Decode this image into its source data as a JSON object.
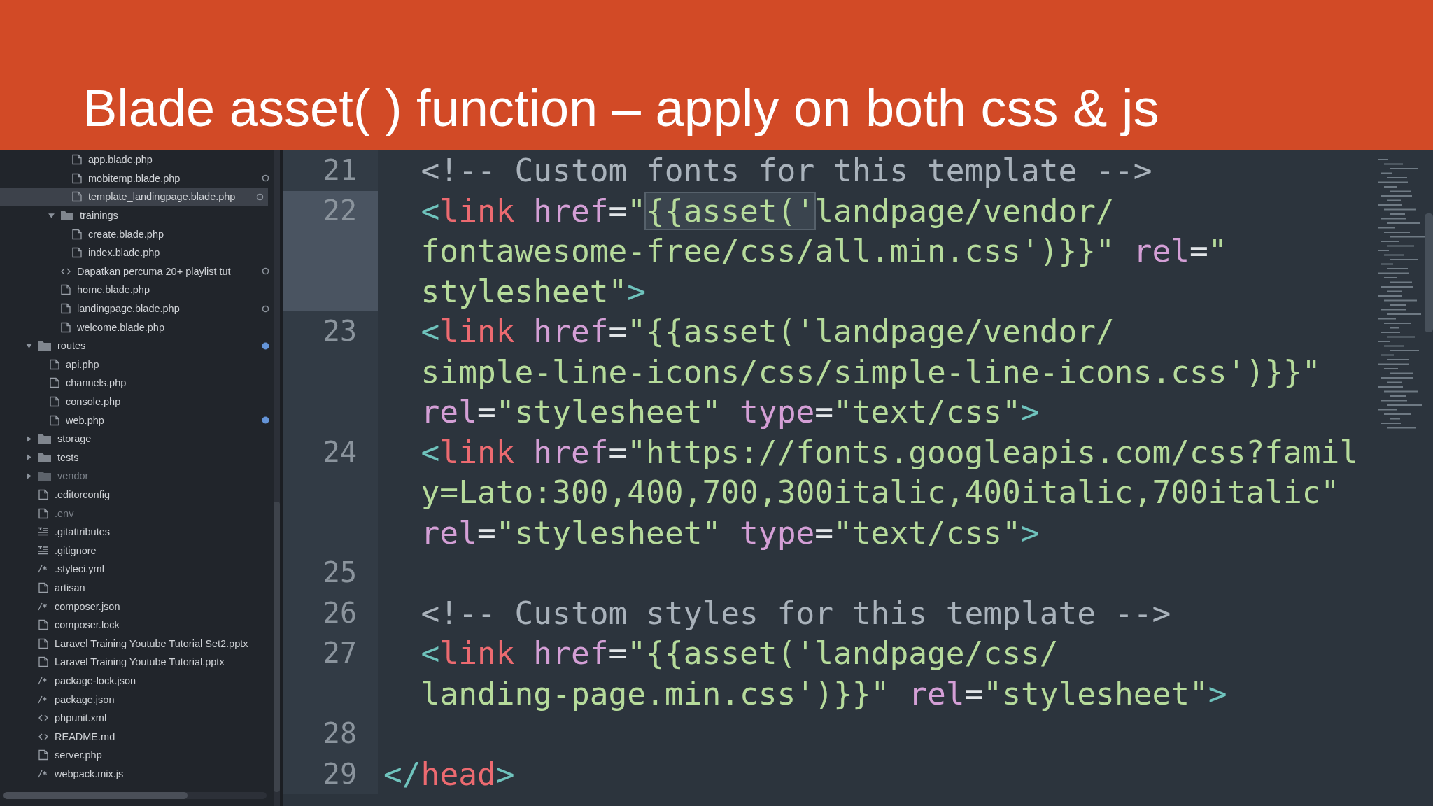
{
  "title": "Blade asset( ) function – apply on both css & js",
  "sidebar": {
    "tree": [
      {
        "children": [
          {
            "children": [
              {
                "children": [
                  {
                    "label": "app.blade.php",
                    "kind": "file",
                    "selected": false,
                    "dimmed": false,
                    "changed": false,
                    "modified": false
                  },
                  {
                    "label": "mobitemp.blade.php",
                    "kind": "file",
                    "selected": false,
                    "dimmed": false,
                    "changed": true,
                    "modified": false
                  },
                  {
                    "label": "template_landingpage.blade.php",
                    "kind": "file",
                    "selected": true,
                    "dimmed": false,
                    "changed": true,
                    "modified": false
                  }
                ]
              },
              {
                "label": "trainings",
                "kind": "folder",
                "expanded": true,
                "selected": false,
                "dimmed": false,
                "changed": false,
                "modified": false,
                "children": [
                  {
                    "label": "create.blade.php",
                    "kind": "file",
                    "selected": false,
                    "dimmed": false,
                    "changed": false,
                    "modified": false
                  },
                  {
                    "label": "index.blade.php",
                    "kind": "file",
                    "selected": false,
                    "dimmed": false,
                    "changed": false,
                    "modified": false
                  }
                ]
              },
              {
                "label": "Dapatkan percuma 20+ playlist tut",
                "kind": "code",
                "selected": false,
                "dimmed": false,
                "changed": true,
                "modified": false
              },
              {
                "label": "home.blade.php",
                "kind": "file",
                "selected": false,
                "dimmed": false,
                "changed": false,
                "modified": false
              },
              {
                "label": "landingpage.blade.php",
                "kind": "file",
                "selected": false,
                "dimmed": false,
                "changed": true,
                "modified": false
              },
              {
                "label": "welcome.blade.php",
                "kind": "file",
                "selected": false,
                "dimmed": false,
                "changed": false,
                "modified": false
              }
            ]
          }
        ]
      },
      {
        "label": "routes",
        "kind": "folder",
        "expanded": true,
        "selected": false,
        "dimmed": false,
        "changed": false,
        "modified": true,
        "children": [
          {
            "label": "api.php",
            "kind": "file",
            "selected": false,
            "dimmed": false,
            "changed": false,
            "modified": false
          },
          {
            "label": "channels.php",
            "kind": "file",
            "selected": false,
            "dimmed": false,
            "changed": false,
            "modified": false
          },
          {
            "label": "console.php",
            "kind": "file",
            "selected": false,
            "dimmed": false,
            "changed": false,
            "modified": false
          },
          {
            "label": "web.php",
            "kind": "file",
            "selected": false,
            "dimmed": false,
            "changed": false,
            "modified": true
          }
        ]
      },
      {
        "label": "storage",
        "kind": "folder",
        "expanded": false,
        "selected": false,
        "dimmed": false,
        "changed": false,
        "modified": false
      },
      {
        "label": "tests",
        "kind": "folder",
        "expanded": false,
        "selected": false,
        "dimmed": false,
        "changed": false,
        "modified": false
      },
      {
        "label": "vendor",
        "kind": "folder",
        "expanded": false,
        "selected": false,
        "dimmed": true,
        "changed": false,
        "modified": false
      },
      {
        "label": ".editorconfig",
        "kind": "file",
        "selected": false,
        "dimmed": false,
        "changed": false,
        "modified": false
      },
      {
        "label": ".env",
        "kind": "file",
        "selected": false,
        "dimmed": true,
        "changed": false,
        "modified": false
      },
      {
        "label": ".gitattributes",
        "kind": "text",
        "selected": false,
        "dimmed": false,
        "changed": false,
        "modified": false
      },
      {
        "label": ".gitignore",
        "kind": "text",
        "selected": false,
        "dimmed": false,
        "changed": false,
        "modified": false
      },
      {
        "label": ".styleci.yml",
        "kind": "config",
        "selected": false,
        "dimmed": false,
        "changed": false,
        "modified": false
      },
      {
        "label": "artisan",
        "kind": "file",
        "selected": false,
        "dimmed": false,
        "changed": false,
        "modified": false
      },
      {
        "label": "composer.json",
        "kind": "config",
        "selected": false,
        "dimmed": false,
        "changed": false,
        "modified": false
      },
      {
        "label": "composer.lock",
        "kind": "file",
        "selected": false,
        "dimmed": false,
        "changed": false,
        "modified": false
      },
      {
        "label": "Laravel Training Youtube Tutorial Set2.pptx",
        "kind": "file",
        "selected": false,
        "dimmed": false,
        "changed": false,
        "modified": false
      },
      {
        "label": "Laravel Training Youtube Tutorial.pptx",
        "kind": "file",
        "selected": false,
        "dimmed": false,
        "changed": false,
        "modified": false
      },
      {
        "label": "package-lock.json",
        "kind": "config",
        "selected": false,
        "dimmed": false,
        "changed": false,
        "modified": false
      },
      {
        "label": "package.json",
        "kind": "config",
        "selected": false,
        "dimmed": false,
        "changed": false,
        "modified": false
      },
      {
        "label": "phpunit.xml",
        "kind": "code",
        "selected": false,
        "dimmed": false,
        "changed": false,
        "modified": false
      },
      {
        "label": "README.md",
        "kind": "code",
        "selected": false,
        "dimmed": false,
        "changed": false,
        "modified": false
      },
      {
        "label": "server.php",
        "kind": "file",
        "selected": false,
        "dimmed": false,
        "changed": false,
        "modified": false
      },
      {
        "label": "webpack.mix.js",
        "kind": "config",
        "selected": false,
        "dimmed": false,
        "changed": false,
        "modified": false
      }
    ]
  },
  "editor": {
    "lines": [
      {
        "number": "21",
        "selected": false,
        "rows": [
          {
            "spans": [
              {
                "kind": "comment",
                "text": "  <!-- Custom fonts for this template -->"
              }
            ]
          }
        ]
      },
      {
        "number": "22",
        "selected": true,
        "rows": [
          {
            "spans": [
              {
                "kind": "bracket",
                "text": "  <"
              },
              {
                "kind": "tag",
                "text": "link"
              },
              {
                "kind": "attr",
                "text": " href"
              },
              {
                "kind": "op",
                "text": "="
              },
              {
                "kind": "string",
                "text": "\""
              },
              {
                "kind": "match",
                "text": "{{asset('"
              },
              {
                "kind": "string",
                "text": "landpage/vendor/"
              }
            ]
          },
          {
            "spans": [
              {
                "kind": "string",
                "text": "  fontawesome-free/css/all.min.css')}}\""
              },
              {
                "kind": "attr",
                "text": " rel"
              },
              {
                "kind": "op",
                "text": "="
              },
              {
                "kind": "string",
                "text": "\""
              }
            ]
          },
          {
            "spans": [
              {
                "kind": "string",
                "text": "  stylesheet\""
              },
              {
                "kind": "bracket",
                "text": ">"
              }
            ]
          }
        ]
      },
      {
        "number": "23",
        "selected": false,
        "rows": [
          {
            "spans": [
              {
                "kind": "bracket",
                "text": "  <"
              },
              {
                "kind": "tag",
                "text": "link"
              },
              {
                "kind": "attr",
                "text": " href"
              },
              {
                "kind": "op",
                "text": "="
              },
              {
                "kind": "string",
                "text": "\"{{asset('landpage/vendor/"
              }
            ]
          },
          {
            "spans": [
              {
                "kind": "string",
                "text": "  simple-line-icons/css/simple-line-icons.css')}}\""
              }
            ]
          },
          {
            "spans": [
              {
                "kind": "attr",
                "text": "  rel"
              },
              {
                "kind": "op",
                "text": "="
              },
              {
                "kind": "string",
                "text": "\"stylesheet\""
              },
              {
                "kind": "attr",
                "text": " type"
              },
              {
                "kind": "op",
                "text": "="
              },
              {
                "kind": "string",
                "text": "\"text/css\""
              },
              {
                "kind": "bracket",
                "text": ">"
              }
            ]
          }
        ]
      },
      {
        "number": "24",
        "selected": false,
        "rows": [
          {
            "spans": [
              {
                "kind": "bracket",
                "text": "  <"
              },
              {
                "kind": "tag",
                "text": "link"
              },
              {
                "kind": "attr",
                "text": " href"
              },
              {
                "kind": "op",
                "text": "="
              },
              {
                "kind": "string",
                "text": "\"https://fonts.googleapis.com/css?famil"
              }
            ]
          },
          {
            "spans": [
              {
                "kind": "string",
                "text": "  y=Lato:300,400,700,300italic,400italic,700italic\""
              }
            ]
          },
          {
            "spans": [
              {
                "kind": "attr",
                "text": "  rel"
              },
              {
                "kind": "op",
                "text": "="
              },
              {
                "kind": "string",
                "text": "\"stylesheet\""
              },
              {
                "kind": "attr",
                "text": " type"
              },
              {
                "kind": "op",
                "text": "="
              },
              {
                "kind": "string",
                "text": "\"text/css\""
              },
              {
                "kind": "bracket",
                "text": ">"
              }
            ]
          }
        ]
      },
      {
        "number": "25",
        "selected": false
      },
      {
        "number": "26",
        "selected": false,
        "rows": [
          {
            "spans": [
              {
                "kind": "comment",
                "text": "  <!-- Custom styles for this template -->"
              }
            ]
          }
        ]
      },
      {
        "number": "27",
        "selected": false,
        "rows": [
          {
            "spans": [
              {
                "kind": "bracket",
                "text": "  <"
              },
              {
                "kind": "tag",
                "text": "link"
              },
              {
                "kind": "attr",
                "text": " href"
              },
              {
                "kind": "op",
                "text": "="
              },
              {
                "kind": "string",
                "text": "\"{{asset('landpage/css/"
              }
            ]
          },
          {
            "spans": [
              {
                "kind": "string",
                "text": "  landing-page.min.css')}}\""
              },
              {
                "kind": "attr",
                "text": " rel"
              },
              {
                "kind": "op",
                "text": "="
              },
              {
                "kind": "string",
                "text": "\"stylesheet\""
              },
              {
                "kind": "bracket",
                "text": ">"
              }
            ]
          }
        ]
      },
      {
        "number": "28",
        "selected": false
      },
      {
        "number": "29",
        "selected": false,
        "rows": [
          {
            "spans": [
              {
                "kind": "bracket",
                "text": "</"
              },
              {
                "kind": "tag",
                "text": "head"
              },
              {
                "kind": "bracket",
                "text": ">"
              }
            ]
          }
        ]
      }
    ]
  }
}
